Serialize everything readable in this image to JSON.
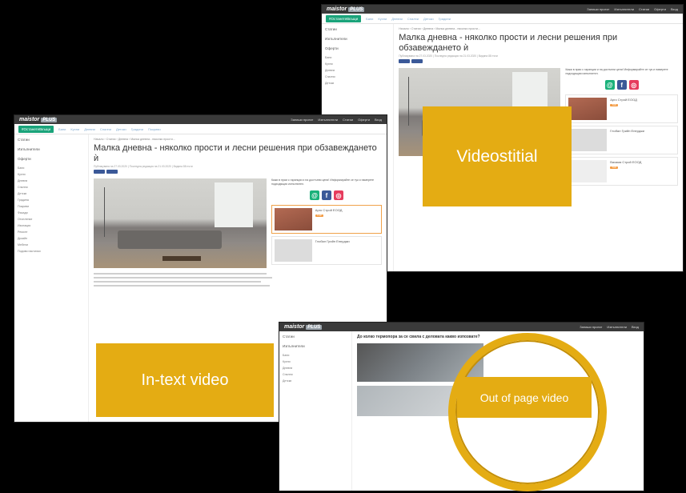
{
  "brand": {
    "logo": "maistor",
    "logo_suffix": "PLUS"
  },
  "top_menu": [
    "Запиши проект",
    "Изпълнители",
    "Статии",
    "Оферти",
    "Вход"
  ],
  "nav": {
    "primary_label": "#ОстанетеВкъщи",
    "items": [
      "Бани",
      "Кухни",
      "Дневни",
      "Спални",
      "Детски",
      "Градини",
      "Покриви",
      "Фасади"
    ]
  },
  "sidebar": {
    "top_items": [
      "Статии",
      "Изпълнители",
      "Оферти"
    ],
    "categories": [
      "Бани",
      "Кухни",
      "Дневни",
      "Спални",
      "Детски",
      "Градина",
      "Покриви",
      "Фасади",
      "Отопление",
      "Изолация",
      "Ремонт",
      "Дизайн",
      "Мебели",
      "Подови настилки"
    ]
  },
  "article": {
    "crumbs": "Начало › Статии › Дневна › Малка дневна - няколко прости...",
    "title": "Малка дневна - няколко прости и лесни решения при обзавеждането ѝ",
    "meta": "Публикувана на 27.03.2020 | Последна редакция на 21.03.2020 | Видяна 88 пъти",
    "sidebar_note": "Кажи в праи с гаранции и на достъпни цени! Информирайте се тук и намерете подходящия изпълнител.",
    "cards": [
      {
        "name": "Арго Строй ЕООД",
        "badge": "TOP"
      },
      {
        "name": "Глобал Грийн Енерджи",
        "badge": ""
      },
      {
        "name": "Вахама Строй ЕООД",
        "badge": "TOP"
      }
    ]
  },
  "bottom_article": {
    "title": "До колко термопора за се свила с деловата какво изпозвате?"
  },
  "ads": {
    "videostitial": "Videostitial",
    "intext": "In-text video",
    "out_of_page": "Out of page video"
  },
  "colors": {
    "accent_green": "#1aa37a",
    "ad_gold": "#e4ac13",
    "topbar": "#3a3a3a"
  }
}
